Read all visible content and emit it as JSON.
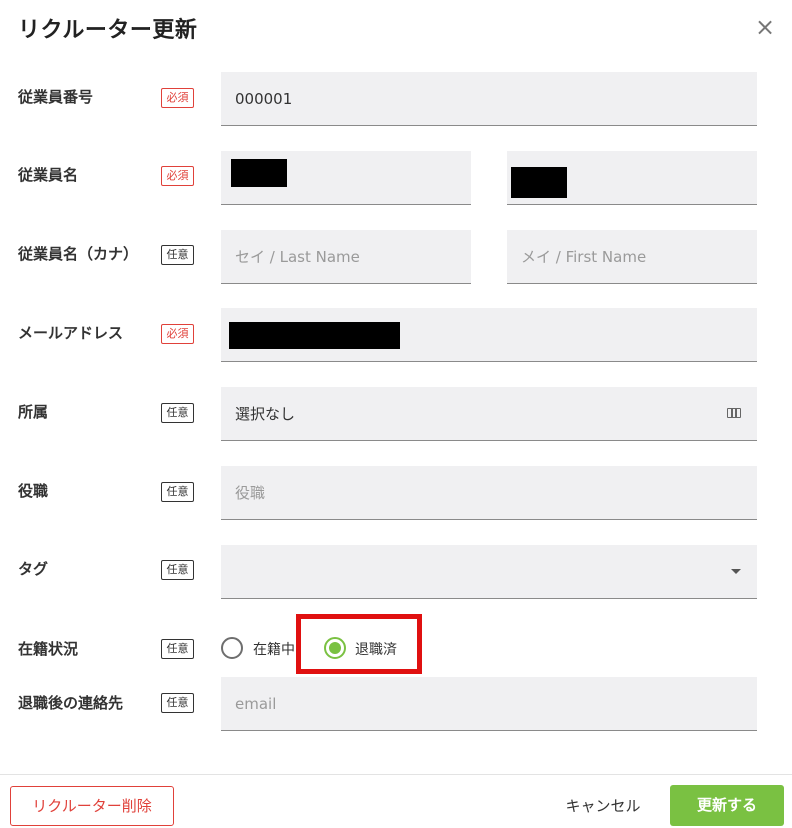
{
  "dialog": {
    "title": "リクルーター更新",
    "close_icon": "close-icon"
  },
  "badges": {
    "required": "必須",
    "optional": "任意"
  },
  "fields": {
    "employee_number": {
      "label": "従業員番号",
      "value": "000001"
    },
    "employee_name": {
      "label": "従業員名"
    },
    "employee_name_kana": {
      "label": "従業員名（カナ）",
      "last_placeholder": "セイ / Last Name",
      "first_placeholder": "メイ / First Name"
    },
    "email": {
      "label": "メールアドレス"
    },
    "department": {
      "label": "所属",
      "value": "選択なし",
      "icon": "table-columns-icon"
    },
    "position": {
      "label": "役職",
      "placeholder": "役職"
    },
    "tag": {
      "label": "タグ",
      "value": "",
      "icon": "chevron-down-icon"
    },
    "status": {
      "label": "在籍状況",
      "options": [
        "在籍中",
        "退職済"
      ],
      "selected": "退職済"
    },
    "contact_after_leaving": {
      "label": "退職後の連絡先",
      "placeholder": "email"
    }
  },
  "footer": {
    "delete_label": "リクルーター削除",
    "cancel_label": "キャンセル",
    "update_label": "更新する"
  },
  "colors": {
    "accent": "#7ac142",
    "required": "#e0413a",
    "highlight": "#e01010",
    "field_bg": "#f0f0f2"
  }
}
